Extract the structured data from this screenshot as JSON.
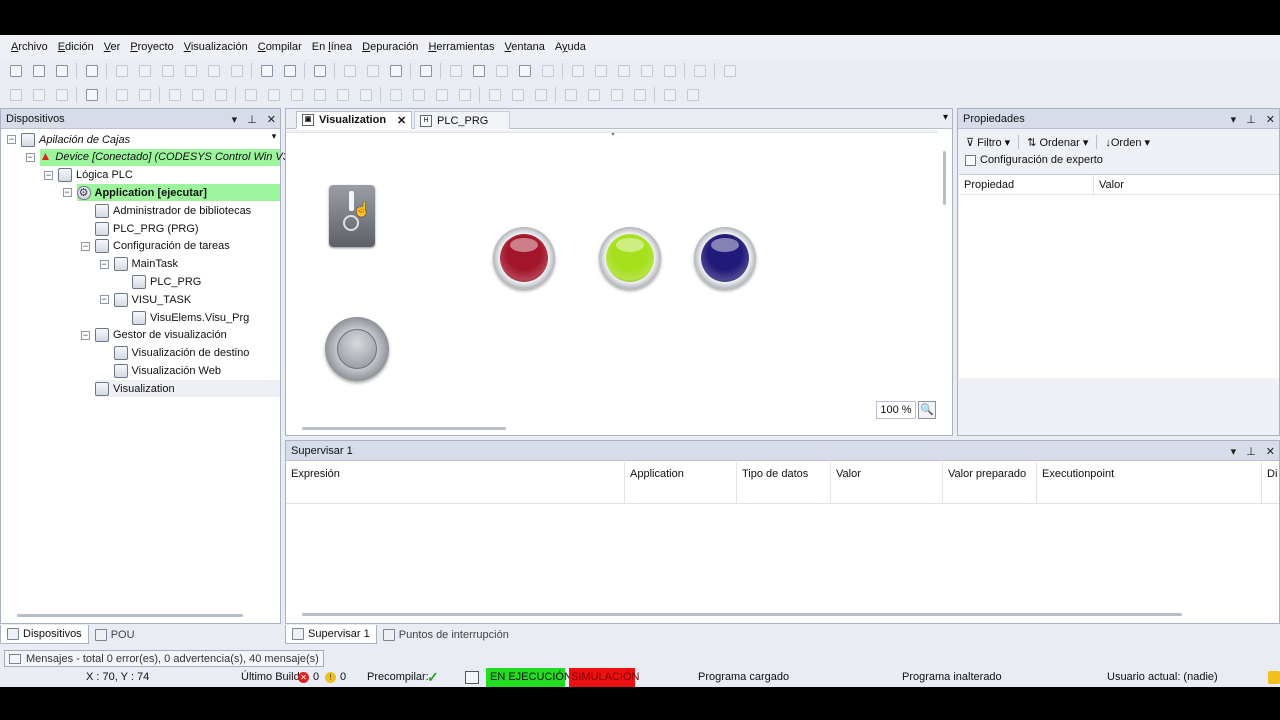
{
  "menu": [
    "Archivo",
    "Edición",
    "Ver",
    "Proyecto",
    "Visualización",
    "Compilar",
    "En línea",
    "Depuración",
    "Herramientas",
    "Ventana",
    "Ayuda"
  ],
  "menu_underline": [
    "A",
    "E",
    "V",
    "P",
    "V",
    "C",
    "l",
    "D",
    "H",
    "V",
    "y"
  ],
  "devices": {
    "title": "Dispositivos",
    "controls": [
      "▾",
      "📌",
      "✕"
    ],
    "tree": [
      {
        "label": "Apilación de Cajas",
        "level": 0,
        "icon": "project-icon",
        "italic": true
      },
      {
        "label": "Device [Conectado] (CODESYS Control Win V3",
        "level": 1,
        "icon": "device-icon",
        "italic": true,
        "highlight": true
      },
      {
        "label": "Lógica PLC",
        "level": 2,
        "icon": "plc-logic-icon"
      },
      {
        "label": "Application [ejecutar]",
        "level": 3,
        "icon": "gear-icon",
        "bold": true,
        "highlight": true
      },
      {
        "label": "Administrador de bibliotecas",
        "level": 4,
        "icon": "library-icon"
      },
      {
        "label": "PLC_PRG (PRG)",
        "level": 4,
        "icon": "pou-icon"
      },
      {
        "label": "Configuración de tareas",
        "level": 4,
        "icon": "task-config-icon"
      },
      {
        "label": "MainTask",
        "level": 5,
        "icon": "task-icon"
      },
      {
        "label": "PLC_PRG",
        "level": 6,
        "icon": "program-call-icon"
      },
      {
        "label": "VISU_TASK",
        "level": 5,
        "icon": "task-icon"
      },
      {
        "label": "VisuElems.Visu_Prg",
        "level": 6,
        "icon": "program-call-icon"
      },
      {
        "label": "Gestor de visualización",
        "level": 4,
        "icon": "visu-manager-icon"
      },
      {
        "label": "Visualización de destino",
        "level": 5,
        "icon": "target-visu-icon"
      },
      {
        "label": "Visualización Web",
        "level": 5,
        "icon": "web-visu-icon"
      },
      {
        "label": "Visualization",
        "level": 4,
        "icon": "visualization-icon",
        "selected": true
      }
    ],
    "tabs": [
      "Dispositivos",
      "POU"
    ]
  },
  "editor": {
    "tabs": [
      {
        "label": "Visualization",
        "active": true,
        "close": "✕"
      },
      {
        "label": "PLC_PRG",
        "active": false
      }
    ],
    "zoom": "100 %",
    "lamps": [
      {
        "name": "red-lamp",
        "color": "#a3152a"
      },
      {
        "name": "green-lamp",
        "color": "#a6e01c"
      },
      {
        "name": "blue-lamp",
        "color": "#221a78"
      }
    ]
  },
  "properties": {
    "title": "Propiedades",
    "filter": "Filtro",
    "sort": "Ordenar",
    "order": "Orden",
    "expert": "Configuración de experto",
    "expert_checked": false,
    "columns": [
      "Propiedad",
      "Valor"
    ]
  },
  "watch": {
    "title": "Supervisar 1",
    "columns": [
      "Expresión",
      "Application",
      "Tipo de datos",
      "Valor",
      "Valor preparado",
      "Executionpoint",
      "Di"
    ],
    "tabs": [
      "Supervisar 1",
      "Puntos de interrupción"
    ]
  },
  "messages": "Mensajes - total 0 error(es), 0 advertencia(s), 40 mensaje(s)",
  "status": {
    "coords": "X : 70, Y : 74",
    "last_build": "Último Build",
    "errors": "0",
    "warnings": "0",
    "precompile": "Precompilar:",
    "running": "EN EJECUCIÓN",
    "simulation": "SIMULACIÓN",
    "program_loaded": "Programa cargado",
    "program_unchanged": "Programa inalterado",
    "user": "Usuario actual: (nadie)",
    "running_color": "#22dd22",
    "simulation_color": "#ee1111"
  }
}
